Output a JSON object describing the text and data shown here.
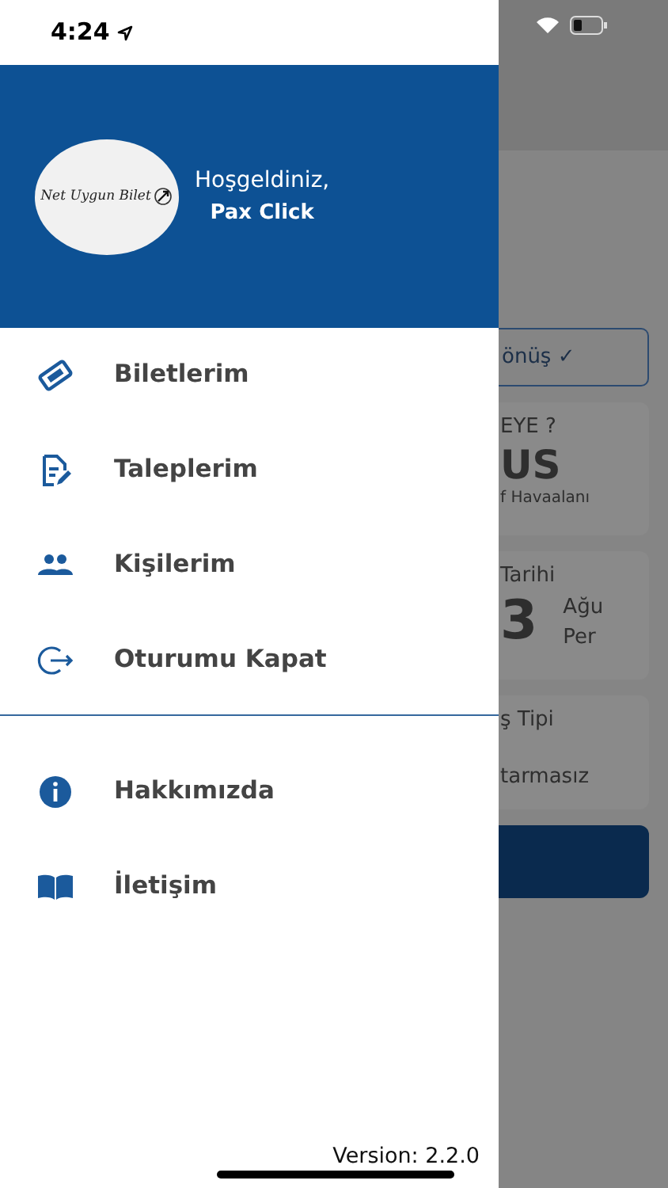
{
  "status_bar": {
    "time": "4:24"
  },
  "drawer": {
    "logo_text": "Net Uygun Bilet",
    "greeting": "Hoşgeldiniz,",
    "user_name": "Pax Click",
    "menu_sections": [
      {
        "items": [
          {
            "kind": "ticket",
            "label": "Biletlerim"
          },
          {
            "kind": "requests",
            "label": "Taleplerim"
          },
          {
            "kind": "people",
            "label": "Kişilerim"
          },
          {
            "kind": "logout",
            "label": "Oturumu Kapat"
          }
        ]
      },
      {
        "items": [
          {
            "kind": "info",
            "label": "Hakkımızda"
          },
          {
            "kind": "contact",
            "label": "İletişim"
          }
        ]
      }
    ],
    "version": "Version: 2.2.0"
  },
  "background_screen": {
    "trip_toggle": "önüş ✓",
    "destination_card": {
      "label": "EYE ?",
      "code": "US",
      "airport": "f Havaalanı"
    },
    "date_card": {
      "label": "Tarihi",
      "day": "3",
      "month": "Ağu",
      "weekday": "Per"
    },
    "type_card": {
      "label": "ş Tipi",
      "value": "tarmasız"
    }
  }
}
